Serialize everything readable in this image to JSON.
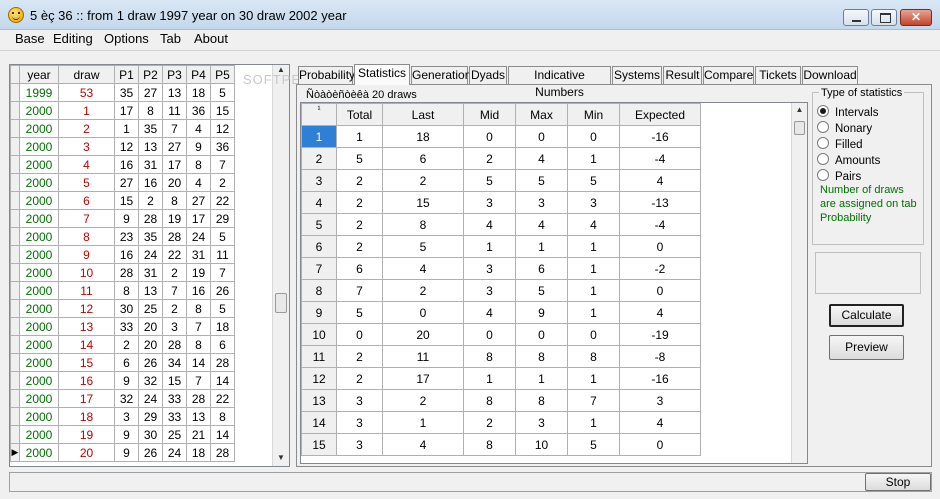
{
  "window": {
    "title": "5 èç 36 :: from 1 draw 1997 year on 30 draw 2002 year"
  },
  "menu": [
    "Base",
    "Editing",
    "Options",
    "Tab",
    "About"
  ],
  "left_grid": {
    "headers": [
      "year",
      "draw",
      "P1",
      "P2",
      "P3",
      "P4",
      "P5"
    ],
    "rows": [
      [
        "1999",
        "53",
        "35",
        "27",
        "13",
        "18",
        "5"
      ],
      [
        "2000",
        "1",
        "17",
        "8",
        "11",
        "36",
        "15"
      ],
      [
        "2000",
        "2",
        "1",
        "35",
        "7",
        "4",
        "12"
      ],
      [
        "2000",
        "3",
        "12",
        "13",
        "27",
        "9",
        "36"
      ],
      [
        "2000",
        "4",
        "16",
        "31",
        "17",
        "8",
        "7"
      ],
      [
        "2000",
        "5",
        "27",
        "16",
        "20",
        "4",
        "2"
      ],
      [
        "2000",
        "6",
        "15",
        "2",
        "8",
        "27",
        "22"
      ],
      [
        "2000",
        "7",
        "9",
        "28",
        "19",
        "17",
        "29"
      ],
      [
        "2000",
        "8",
        "23",
        "35",
        "28",
        "24",
        "5"
      ],
      [
        "2000",
        "9",
        "16",
        "24",
        "22",
        "31",
        "11"
      ],
      [
        "2000",
        "10",
        "28",
        "31",
        "2",
        "19",
        "7"
      ],
      [
        "2000",
        "11",
        "8",
        "13",
        "7",
        "16",
        "26"
      ],
      [
        "2000",
        "12",
        "30",
        "25",
        "2",
        "8",
        "5"
      ],
      [
        "2000",
        "13",
        "33",
        "20",
        "3",
        "7",
        "18"
      ],
      [
        "2000",
        "14",
        "2",
        "20",
        "28",
        "8",
        "6"
      ],
      [
        "2000",
        "15",
        "6",
        "26",
        "34",
        "14",
        "28"
      ],
      [
        "2000",
        "16",
        "9",
        "32",
        "15",
        "7",
        "14"
      ],
      [
        "2000",
        "17",
        "32",
        "24",
        "33",
        "28",
        "22"
      ],
      [
        "2000",
        "18",
        "3",
        "29",
        "33",
        "13",
        "8"
      ],
      [
        "2000",
        "19",
        "9",
        "30",
        "25",
        "21",
        "14"
      ],
      [
        "2000",
        "20",
        "9",
        "26",
        "24",
        "18",
        "28"
      ]
    ],
    "current_row_marker": "▶"
  },
  "tabs": [
    "Probability",
    "Statistics",
    "Generation",
    "Dyads",
    "Indicative Numbers",
    "Systems",
    "Result",
    "Compare",
    "Tickets",
    "Download"
  ],
  "active_tab": "Statistics",
  "stats": {
    "group_label": "Ñòàòèñòèêà 20 draws",
    "corner_mark": "¹",
    "headers": [
      "Total",
      "Last",
      "Mid",
      "Max",
      "Min",
      "Expected"
    ],
    "rows": [
      [
        "1",
        "1",
        "18",
        "0",
        "0",
        "0",
        "-16"
      ],
      [
        "2",
        "5",
        "6",
        "2",
        "4",
        "1",
        "-4"
      ],
      [
        "3",
        "2",
        "2",
        "5",
        "5",
        "5",
        "4"
      ],
      [
        "4",
        "2",
        "15",
        "3",
        "3",
        "3",
        "-13"
      ],
      [
        "5",
        "2",
        "8",
        "4",
        "4",
        "4",
        "-4"
      ],
      [
        "6",
        "2",
        "5",
        "1",
        "1",
        "1",
        "0"
      ],
      [
        "7",
        "6",
        "4",
        "3",
        "6",
        "1",
        "-2"
      ],
      [
        "8",
        "7",
        "2",
        "3",
        "5",
        "1",
        "0"
      ],
      [
        "9",
        "5",
        "0",
        "4",
        "9",
        "1",
        "4"
      ],
      [
        "10",
        "0",
        "20",
        "0",
        "0",
        "0",
        "-19"
      ],
      [
        "11",
        "2",
        "11",
        "8",
        "8",
        "8",
        "-8"
      ],
      [
        "12",
        "2",
        "17",
        "1",
        "1",
        "1",
        "-16"
      ],
      [
        "13",
        "3",
        "2",
        "8",
        "8",
        "7",
        "3"
      ],
      [
        "14",
        "3",
        "1",
        "2",
        "3",
        "1",
        "4"
      ],
      [
        "15",
        "3",
        "4",
        "8",
        "10",
        "5",
        "0"
      ]
    ]
  },
  "stat_type": {
    "title": "Type of statistics",
    "options": [
      "Intervals",
      "Nonary",
      "Filled",
      "Amounts",
      "Pairs"
    ],
    "selected": "Intervals",
    "note": "Number of draws are assigned on tab Probability"
  },
  "buttons": {
    "calculate": "Calculate",
    "preview": "Preview",
    "stop": "Stop"
  },
  "watermark": "SOFTPEDIA",
  "colors": {
    "year_text": "#007000",
    "draw_text": "#c00000",
    "selected_row": "#2f7fd6",
    "note_text": "#007000"
  }
}
